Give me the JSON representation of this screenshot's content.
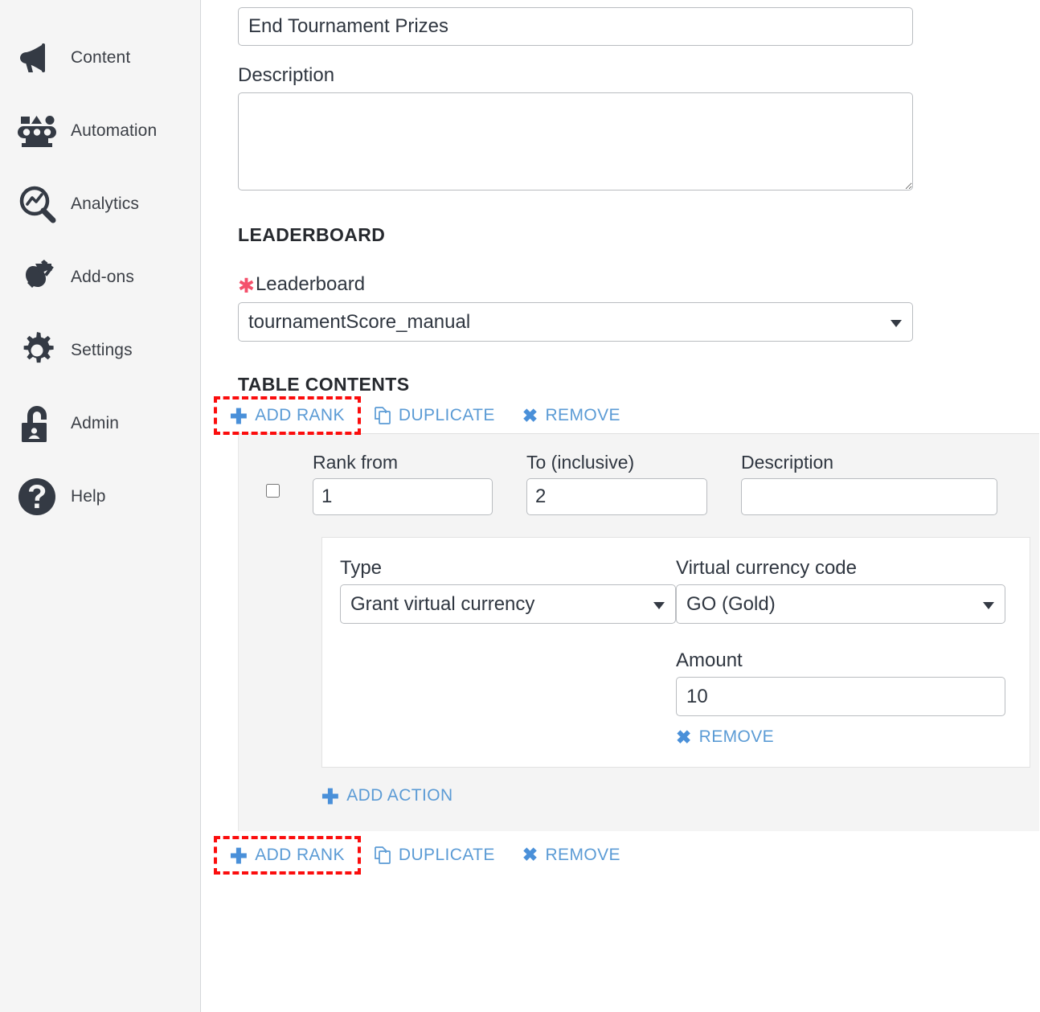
{
  "sidebar": {
    "items": [
      {
        "label": "Content",
        "icon": "megaphone-icon"
      },
      {
        "label": "Automation",
        "icon": "automation-conveyor-icon"
      },
      {
        "label": "Analytics",
        "icon": "magnifier-chart-icon"
      },
      {
        "label": "Add-ons",
        "icon": "plug-icon"
      },
      {
        "label": "Settings",
        "icon": "gear-icon"
      },
      {
        "label": "Admin",
        "icon": "lock-user-icon"
      },
      {
        "label": "Help",
        "icon": "question-circle-icon"
      }
    ]
  },
  "form": {
    "title_value": "End Tournament Prizes",
    "title_placeholder": "",
    "description_label": "Description",
    "description_value": "",
    "description_placeholder": ""
  },
  "leaderboard_section": {
    "heading": "LEADERBOARD",
    "field_label": "Leaderboard",
    "required_marker": "✱",
    "selected": "tournamentScore_manual",
    "options": [
      "tournamentScore_manual"
    ]
  },
  "table_contents": {
    "heading": "TABLE CONTENTS",
    "toolbar": {
      "add_rank": "ADD RANK",
      "duplicate": "DUPLICATE",
      "remove": "REMOVE",
      "add_rank_icon": "plus-icon",
      "duplicate_icon": "copy-icon",
      "remove_icon": "close-x-icon",
      "highlighted": "add-rank"
    },
    "rank_row": {
      "checkbox_checked": false,
      "rank_from_label": "Rank from",
      "rank_from_value": "1",
      "to_label": "To (inclusive)",
      "to_value": "2",
      "description_label": "Description",
      "description_value": "",
      "action": {
        "type_label": "Type",
        "type_selected": "Grant virtual currency",
        "type_options": [
          "Grant virtual currency"
        ],
        "currency_label": "Virtual currency code",
        "currency_selected": "GO (Gold)",
        "currency_options": [
          "GO (Gold)"
        ],
        "amount_label": "Amount",
        "amount_value": "10",
        "remove_label": "REMOVE",
        "remove_icon": "close-x-icon"
      },
      "add_action_label": "ADD ACTION",
      "add_action_icon": "plus-icon"
    },
    "bottom_toolbar": {
      "add_rank": "ADD RANK",
      "duplicate": "DUPLICATE",
      "remove": "REMOVE",
      "add_rank_icon": "plus-icon",
      "duplicate_icon": "copy-icon",
      "remove_icon": "close-x-icon",
      "highlighted": "add-rank"
    }
  },
  "colors": {
    "link_blue": "#5b9bd5",
    "icon_blue": "#4a90d9",
    "highlight_red": "#fb0d0d",
    "required_pink": "#f4506b",
    "sidebar_bg": "#f5f5f5",
    "panel_bg": "#f4f4f4",
    "text_dark": "#2f3640"
  }
}
